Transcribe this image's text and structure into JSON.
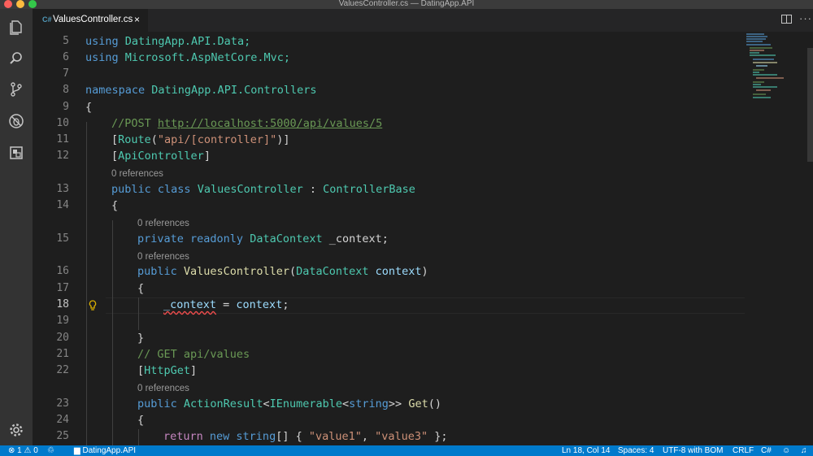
{
  "window": {
    "title": "ValuesController.cs — DatingApp.API"
  },
  "activity_bar": {
    "icons": [
      "files-icon",
      "search-icon",
      "source-control-icon",
      "debug-icon",
      "extensions-icon",
      "gear-icon"
    ]
  },
  "tab": {
    "icon_text": "C#",
    "label": "ValuesController.cs",
    "close": "×"
  },
  "editor_actions": {
    "more": "···"
  },
  "code_lens": {
    "zero_refs": "0 references"
  },
  "code": {
    "l5": {
      "kw": "using",
      "ns": " DatingApp.API.Data;"
    },
    "l6": {
      "kw": "using",
      "ns": " Microsoft.AspNetCore.Mvc;"
    },
    "l8": {
      "kw": "namespace",
      "ns": " DatingApp.API.Controllers"
    },
    "l9": "{",
    "l10": {
      "prefix": "//POST ",
      "url": "http://localhost:5000/api/values/5"
    },
    "l11": {
      "open": "[",
      "attr": "Route",
      "p1": "(",
      "str": "\"api/[controller]\"",
      "p2": ")]"
    },
    "l12": {
      "open": "[",
      "attr": "ApiController",
      "close": "]"
    },
    "l13": {
      "kw1": "public",
      "kw2": " class",
      "name": " ValuesController",
      "colon": " : ",
      "base": "ControllerBase"
    },
    "l14": "{",
    "l15": {
      "kw1": "private",
      "kw2": " readonly",
      "type": " DataContext",
      "field": " _context;"
    },
    "l16": {
      "kw1": "public",
      "fn": " ValuesController",
      "p1": "(",
      "type": "DataContext",
      "param": " context",
      "p2": ")"
    },
    "l17": "{",
    "l18": {
      "field": "_context",
      "op": " = ",
      "param": "context",
      "end": ";"
    },
    "l20": "}",
    "l21": "// GET api/values",
    "l22": {
      "open": "[",
      "attr": "HttpGet",
      "close": "]"
    },
    "l23": {
      "kw1": "public",
      "type1": " ActionResult",
      "lt1": "<",
      "type2": "IEnumerable",
      "lt2": "<",
      "kw2": "string",
      "gt": ">>",
      "fn": " Get",
      "paren": "()"
    },
    "l24": "{",
    "l25": {
      "ctl": "return",
      "kw1": " new",
      "kw2": " string",
      "br": "[] { ",
      "s1": "\"value1\"",
      "comma": ", ",
      "s2": "\"value3\"",
      "end": " };"
    }
  },
  "line_numbers": {
    "n5": "5",
    "n6": "6",
    "n7": "7",
    "n8": "8",
    "n9": "9",
    "n10": "10",
    "n11": "11",
    "n12": "12",
    "n13": "13",
    "n14": "14",
    "n15": "15",
    "n16": "16",
    "n17": "17",
    "n18": "18",
    "n19": "19",
    "n20": "20",
    "n21": "21",
    "n22": "22",
    "n23": "23",
    "n24": "24",
    "n25": "25"
  },
  "status_bar": {
    "errors": "1",
    "warnings": "0",
    "folder": "DatingApp.API",
    "position": "Ln 18, Col 14",
    "spaces": "Spaces: 4",
    "encoding": "UTF-8 with BOM",
    "eol": "CRLF",
    "language": "C#"
  },
  "colors": {
    "editor_bg": "#1e1e1e",
    "activity_bg": "#333333",
    "statusbar_bg": "#007acc",
    "keyword": "#569cd6",
    "type": "#4ec9b0",
    "string": "#ce9178",
    "comment": "#6a9955"
  }
}
